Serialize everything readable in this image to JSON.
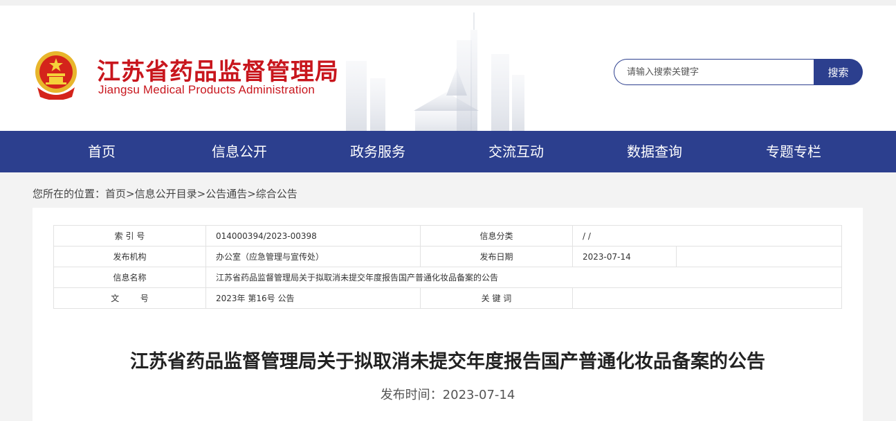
{
  "header": {
    "title_cn": "江苏省药品监督管理局",
    "title_en": "Jiangsu Medical Products Administration",
    "emblem_icon": "national-emblem-icon"
  },
  "search": {
    "placeholder": "请输入搜索关键字",
    "button_label": "搜索"
  },
  "nav": {
    "items": [
      {
        "label": "首页"
      },
      {
        "label": "信息公开"
      },
      {
        "label": "政务服务"
      },
      {
        "label": "交流互动"
      },
      {
        "label": "数据查询"
      },
      {
        "label": "专题专栏"
      }
    ]
  },
  "breadcrumb": {
    "prefix": "您所在的位置：",
    "items": [
      "首页",
      "信息公开目录",
      "公告通告",
      "综合公告"
    ],
    "separator": ">"
  },
  "info_table": {
    "index_label": "索 引 号",
    "index_value": "014000394/2023-00398",
    "category_label": "信息分类",
    "category_value": "/      /",
    "org_label": "发布机构",
    "org_value": "办公室（应急管理与宣传处）",
    "date_label": "发布日期",
    "date_value": "2023-07-14",
    "name_label": "信息名称",
    "name_value": "江苏省药品监督管理局关于拟取消未提交年度报告国产普通化妆品备案的公告",
    "doc_no_label": "文        号",
    "doc_no_value": "2023年 第16号 公告",
    "keywords_label": "关 键 词",
    "keywords_value": ""
  },
  "article": {
    "title": "江苏省药品监督管理局关于拟取消未提交年度报告国产普通化妆品备案的公告",
    "publish_time": "发布时间：2023-07-14"
  },
  "colors": {
    "brand_red": "#c8161d",
    "nav_blue": "#2c3f8e",
    "page_bg": "#f3f3f3"
  }
}
